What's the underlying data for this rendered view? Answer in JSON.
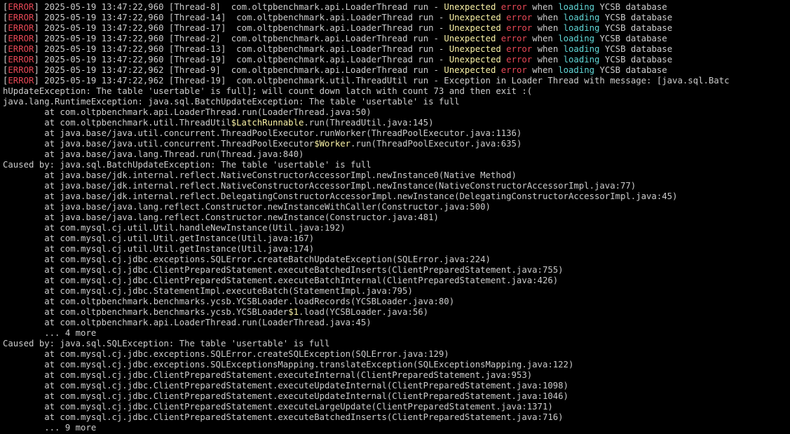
{
  "terminal": {
    "colors": {
      "background": "#000000",
      "default": "#cccccc",
      "red": "#e74856",
      "yellow": "#f9f1a5",
      "cyan": "#61d6d6"
    },
    "lines": [
      [
        {
          "t": "[",
          "c": "default"
        },
        {
          "t": "ERROR",
          "c": "red"
        },
        {
          "t": "] 2025-05-19 13:47:22,960 [Thread-8]  com.oltpbenchmark.api.LoaderThread run - ",
          "c": "default"
        },
        {
          "t": "Unexpected",
          "c": "yellow"
        },
        {
          "t": " ",
          "c": "default"
        },
        {
          "t": "error",
          "c": "red"
        },
        {
          "t": " when ",
          "c": "default"
        },
        {
          "t": "loading",
          "c": "cyan"
        },
        {
          "t": " YCSB database",
          "c": "default"
        }
      ],
      [
        {
          "t": "[",
          "c": "default"
        },
        {
          "t": "ERROR",
          "c": "red"
        },
        {
          "t": "] 2025-05-19 13:47:22,960 [Thread-14]  com.oltpbenchmark.api.LoaderThread run - ",
          "c": "default"
        },
        {
          "t": "Unexpected",
          "c": "yellow"
        },
        {
          "t": " ",
          "c": "default"
        },
        {
          "t": "error",
          "c": "red"
        },
        {
          "t": " when ",
          "c": "default"
        },
        {
          "t": "loading",
          "c": "cyan"
        },
        {
          "t": " YCSB database",
          "c": "default"
        }
      ],
      [
        {
          "t": "[",
          "c": "default"
        },
        {
          "t": "ERROR",
          "c": "red"
        },
        {
          "t": "] 2025-05-19 13:47:22,960 [Thread-17]  com.oltpbenchmark.api.LoaderThread run - ",
          "c": "default"
        },
        {
          "t": "Unexpected",
          "c": "yellow"
        },
        {
          "t": " ",
          "c": "default"
        },
        {
          "t": "error",
          "c": "red"
        },
        {
          "t": " when ",
          "c": "default"
        },
        {
          "t": "loading",
          "c": "cyan"
        },
        {
          "t": " YCSB database",
          "c": "default"
        }
      ],
      [
        {
          "t": "[",
          "c": "default"
        },
        {
          "t": "ERROR",
          "c": "red"
        },
        {
          "t": "] 2025-05-19 13:47:22,960 [Thread-2]  com.oltpbenchmark.api.LoaderThread run - ",
          "c": "default"
        },
        {
          "t": "Unexpected",
          "c": "yellow"
        },
        {
          "t": " ",
          "c": "default"
        },
        {
          "t": "error",
          "c": "red"
        },
        {
          "t": " when ",
          "c": "default"
        },
        {
          "t": "loading",
          "c": "cyan"
        },
        {
          "t": " YCSB database",
          "c": "default"
        }
      ],
      [
        {
          "t": "[",
          "c": "default"
        },
        {
          "t": "ERROR",
          "c": "red"
        },
        {
          "t": "] 2025-05-19 13:47:22,960 [Thread-13]  com.oltpbenchmark.api.LoaderThread run - ",
          "c": "default"
        },
        {
          "t": "Unexpected",
          "c": "yellow"
        },
        {
          "t": " ",
          "c": "default"
        },
        {
          "t": "error",
          "c": "red"
        },
        {
          "t": " when ",
          "c": "default"
        },
        {
          "t": "loading",
          "c": "cyan"
        },
        {
          "t": " YCSB database",
          "c": "default"
        }
      ],
      [
        {
          "t": "[",
          "c": "default"
        },
        {
          "t": "ERROR",
          "c": "red"
        },
        {
          "t": "] 2025-05-19 13:47:22,960 [Thread-19]  com.oltpbenchmark.api.LoaderThread run - ",
          "c": "default"
        },
        {
          "t": "Unexpected",
          "c": "yellow"
        },
        {
          "t": " ",
          "c": "default"
        },
        {
          "t": "error",
          "c": "red"
        },
        {
          "t": " when ",
          "c": "default"
        },
        {
          "t": "loading",
          "c": "cyan"
        },
        {
          "t": " YCSB database",
          "c": "default"
        }
      ],
      [
        {
          "t": "[",
          "c": "default"
        },
        {
          "t": "ERROR",
          "c": "red"
        },
        {
          "t": "] 2025-05-19 13:47:22,962 [Thread-9]  com.oltpbenchmark.api.LoaderThread run - ",
          "c": "default"
        },
        {
          "t": "Unexpected",
          "c": "yellow"
        },
        {
          "t": " ",
          "c": "default"
        },
        {
          "t": "error",
          "c": "red"
        },
        {
          "t": " when ",
          "c": "default"
        },
        {
          "t": "loading",
          "c": "cyan"
        },
        {
          "t": " YCSB database",
          "c": "default"
        }
      ],
      [
        {
          "t": "[",
          "c": "default"
        },
        {
          "t": "ERROR",
          "c": "red"
        },
        {
          "t": "] 2025-05-19 13:47:22,962 [Thread-19]  com.oltpbenchmark.util.ThreadUtil run - Exception in Loader Thread with message: [java.sql.Batc",
          "c": "default"
        }
      ],
      [
        {
          "t": "hUpdateException: The table 'usertable' is full]; will count down latch with count 73 and then exit :(",
          "c": "default"
        }
      ],
      [
        {
          "t": "java.lang.RuntimeException: java.sql.BatchUpdateException: The table 'usertable' is full",
          "c": "default"
        }
      ],
      [
        {
          "t": "        at com.oltpbenchmark.api.LoaderThread.run(LoaderThread.java:50)",
          "c": "default"
        }
      ],
      [
        {
          "t": "        at com.oltpbenchmark.util.ThreadUtil",
          "c": "default"
        },
        {
          "t": "$LatchRunnable",
          "c": "yellow"
        },
        {
          "t": ".run(ThreadUtil.java:145)",
          "c": "default"
        }
      ],
      [
        {
          "t": "        at java.base/java.util.concurrent.ThreadPoolExecutor.runWorker(ThreadPoolExecutor.java:1136)",
          "c": "default"
        }
      ],
      [
        {
          "t": "        at java.base/java.util.concurrent.ThreadPoolExecutor",
          "c": "default"
        },
        {
          "t": "$Worker",
          "c": "yellow"
        },
        {
          "t": ".run(ThreadPoolExecutor.java:635)",
          "c": "default"
        }
      ],
      [
        {
          "t": "        at java.base/java.lang.Thread.run(Thread.java:840)",
          "c": "default"
        }
      ],
      [
        {
          "t": "Caused by: java.sql.BatchUpdateException: The table 'usertable' is full",
          "c": "default"
        }
      ],
      [
        {
          "t": "        at java.base/jdk.internal.reflect.NativeConstructorAccessorImpl.newInstance0(Native Method)",
          "c": "default"
        }
      ],
      [
        {
          "t": "        at java.base/jdk.internal.reflect.NativeConstructorAccessorImpl.newInstance(NativeConstructorAccessorImpl.java:77)",
          "c": "default"
        }
      ],
      [
        {
          "t": "        at java.base/jdk.internal.reflect.DelegatingConstructorAccessorImpl.newInstance(DelegatingConstructorAccessorImpl.java:45)",
          "c": "default"
        }
      ],
      [
        {
          "t": "        at java.base/java.lang.reflect.Constructor.newInstanceWithCaller(Constructor.java:500)",
          "c": "default"
        }
      ],
      [
        {
          "t": "        at java.base/java.lang.reflect.Constructor.newInstance(Constructor.java:481)",
          "c": "default"
        }
      ],
      [
        {
          "t": "        at com.mysql.cj.util.Util.handleNewInstance(Util.java:192)",
          "c": "default"
        }
      ],
      [
        {
          "t": "        at com.mysql.cj.util.Util.getInstance(Util.java:167)",
          "c": "default"
        }
      ],
      [
        {
          "t": "        at com.mysql.cj.util.Util.getInstance(Util.java:174)",
          "c": "default"
        }
      ],
      [
        {
          "t": "        at com.mysql.cj.jdbc.exceptions.SQLError.createBatchUpdateException(SQLError.java:224)",
          "c": "default"
        }
      ],
      [
        {
          "t": "        at com.mysql.cj.jdbc.ClientPreparedStatement.executeBatchedInserts(ClientPreparedStatement.java:755)",
          "c": "default"
        }
      ],
      [
        {
          "t": "        at com.mysql.cj.jdbc.ClientPreparedStatement.executeBatchInternal(ClientPreparedStatement.java:426)",
          "c": "default"
        }
      ],
      [
        {
          "t": "        at com.mysql.cj.jdbc.StatementImpl.executeBatch(StatementImpl.java:795)",
          "c": "default"
        }
      ],
      [
        {
          "t": "        at com.oltpbenchmark.benchmarks.ycsb.YCSBLoader.loadRecords(YCSBLoader.java:80)",
          "c": "default"
        }
      ],
      [
        {
          "t": "        at com.oltpbenchmark.benchmarks.ycsb.YCSBLoader",
          "c": "default"
        },
        {
          "t": "$1",
          "c": "yellow"
        },
        {
          "t": ".load(YCSBLoader.java:56)",
          "c": "default"
        }
      ],
      [
        {
          "t": "        at com.oltpbenchmark.api.LoaderThread.run(LoaderThread.java:45)",
          "c": "default"
        }
      ],
      [
        {
          "t": "        ... 4 more",
          "c": "default"
        }
      ],
      [
        {
          "t": "Caused by: java.sql.SQLException: The table 'usertable' is full",
          "c": "default"
        }
      ],
      [
        {
          "t": "        at com.mysql.cj.jdbc.exceptions.SQLError.createSQLException(SQLError.java:129)",
          "c": "default"
        }
      ],
      [
        {
          "t": "        at com.mysql.cj.jdbc.exceptions.SQLExceptionsMapping.translateException(SQLExceptionsMapping.java:122)",
          "c": "default"
        }
      ],
      [
        {
          "t": "        at com.mysql.cj.jdbc.ClientPreparedStatement.executeInternal(ClientPreparedStatement.java:953)",
          "c": "default"
        }
      ],
      [
        {
          "t": "        at com.mysql.cj.jdbc.ClientPreparedStatement.executeUpdateInternal(ClientPreparedStatement.java:1098)",
          "c": "default"
        }
      ],
      [
        {
          "t": "        at com.mysql.cj.jdbc.ClientPreparedStatement.executeUpdateInternal(ClientPreparedStatement.java:1046)",
          "c": "default"
        }
      ],
      [
        {
          "t": "        at com.mysql.cj.jdbc.ClientPreparedStatement.executeLargeUpdate(ClientPreparedStatement.java:1371)",
          "c": "default"
        }
      ],
      [
        {
          "t": "        at com.mysql.cj.jdbc.ClientPreparedStatement.executeBatchedInserts(ClientPreparedStatement.java:716)",
          "c": "default"
        }
      ],
      [
        {
          "t": "        ... 9 more",
          "c": "default"
        }
      ]
    ]
  }
}
